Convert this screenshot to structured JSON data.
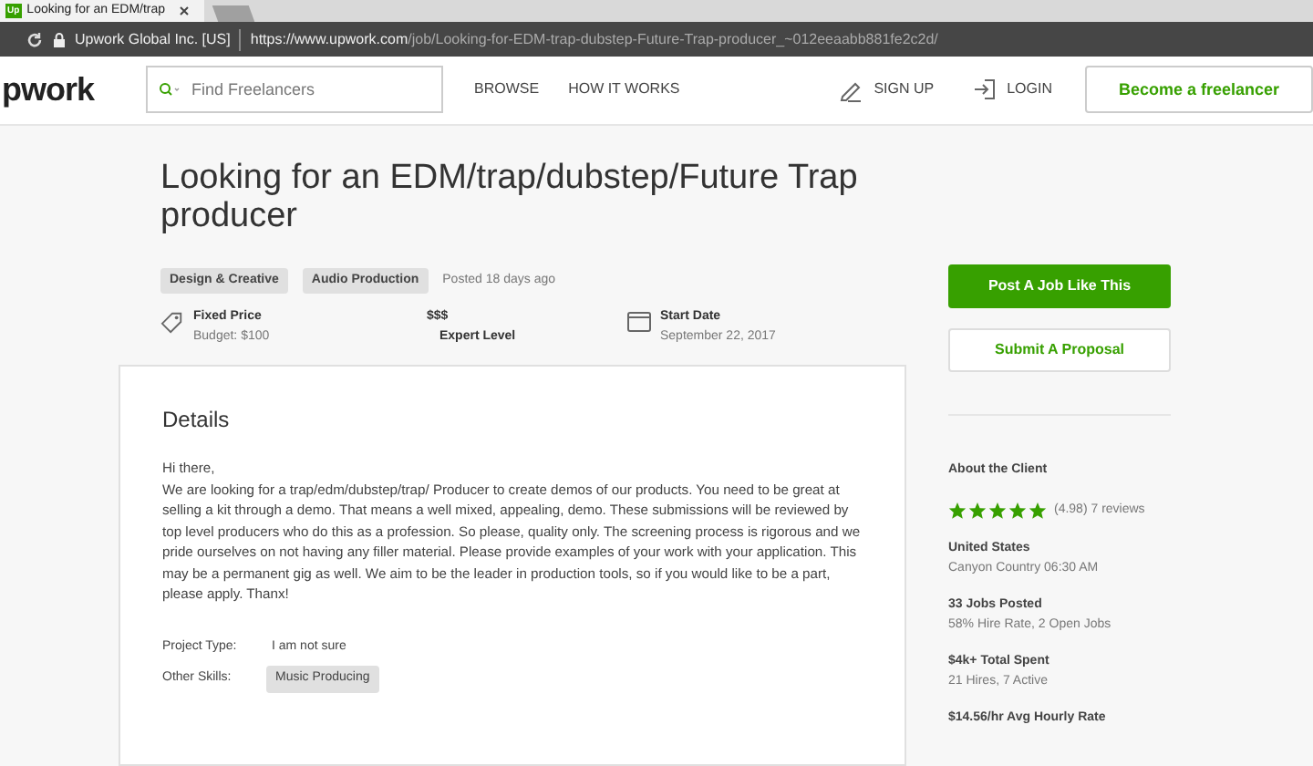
{
  "browser": {
    "tab_title": "Looking for an EDM/trap",
    "favicon": "Up",
    "site_identity": "Upwork Global Inc. [US]",
    "url_host": "https://www.upwork.com",
    "url_path": "/job/Looking-for-EDM-trap-dubstep-Future-Trap-producer_~012eeaabb881fe2c2d/"
  },
  "header": {
    "logo": "pwork",
    "search": {
      "placeholder": "Find Freelancers"
    },
    "nav": [
      "BROWSE",
      "HOW IT WORKS"
    ],
    "sign_up": "SIGN UP",
    "login": "LOGIN",
    "cta": "Become a freelancer"
  },
  "job": {
    "title": "Looking for an EDM/trap/dubstep/Future Trap producer",
    "tags": [
      "Design & Creative",
      "Audio Production"
    ],
    "posted": "Posted 18 days ago",
    "facts": [
      {
        "kind": "price",
        "label": "Fixed Price",
        "detail": "Budget: $100"
      },
      {
        "kind": "level",
        "label": "$$$",
        "detail": "Expert Level"
      },
      {
        "kind": "date",
        "label": "Start Date",
        "detail": "September 22, 2017"
      }
    ]
  },
  "details": {
    "heading": "Details",
    "greeting": "Hi there,",
    "body": "We are looking for a trap/edm/dubstep/trap/ Producer to create demos of our products. You need to be great at selling a kit through a demo. That means a well mixed, appealing, demo. These submissions will be reviewed by top level producers who do this as a profession. So please, quality only. The screening process is rigorous and we pride ourselves on not having any filler material.  Please provide examples of your work with your application. This may be a permanent gig as well. We aim to be the leader in production tools, so if you would like to be a part, please apply. Thanx!",
    "project_type_label": "Project Type:",
    "project_type": "I am not sure",
    "skills_label": "Other Skills:",
    "skills": [
      "Music Producing"
    ]
  },
  "sidebar": {
    "post_button": "Post A Job Like This",
    "proposal_button": "Submit A Proposal",
    "client_heading": "About the Client",
    "stars": 5,
    "rating": "(4.98) 7 reviews",
    "stats": [
      {
        "title": "United States",
        "detail": "Canyon Country 06:30 AM"
      },
      {
        "title": "33 Jobs Posted",
        "detail": "58% Hire Rate, 2 Open Jobs"
      },
      {
        "title": "$4k+ Total Spent",
        "detail": "21 Hires, 7 Active"
      },
      {
        "title": "$14.56/hr Avg Hourly Rate"
      }
    ]
  }
}
